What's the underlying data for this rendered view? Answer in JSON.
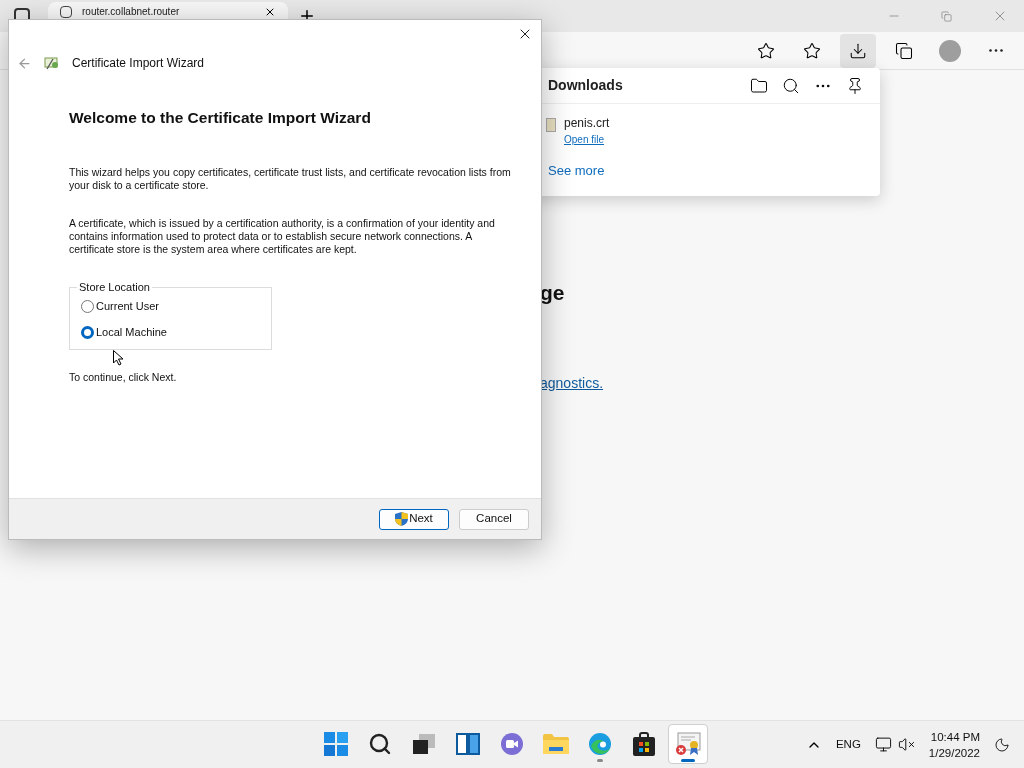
{
  "browser": {
    "tab": {
      "title": "router.collabnet.router"
    },
    "toolbar": [
      {
        "kind": "favorite-add",
        "selected": false
      },
      {
        "kind": "favorites",
        "selected": false
      },
      {
        "kind": "downloads",
        "selected": true
      },
      {
        "kind": "collections",
        "selected": false
      },
      {
        "kind": "profile",
        "selected": false
      },
      {
        "kind": "more",
        "selected": false
      }
    ],
    "page": {
      "heading": "ge",
      "link": "agnostics."
    }
  },
  "downloads": {
    "title": "Downloads",
    "items": [
      {
        "name": "penis.crt",
        "action": "Open file"
      }
    ],
    "see_more": "See more"
  },
  "dialog": {
    "title": "Certificate Import Wizard",
    "heading": "Welcome to the Certificate Import Wizard",
    "paragraphs": [
      "This wizard helps you copy certificates, certificate trust lists, and certificate revocation lists from your disk to a certificate store.",
      "A certificate, which is issued by a certification authority, is a confirmation of your identity and contains information used to protect data or to establish secure network connections. A certificate store is the system area where certificates are kept."
    ],
    "store_location": {
      "legend": "Store Location",
      "options": [
        {
          "label": "Current User",
          "selected": false
        },
        {
          "label": "Local Machine",
          "selected": true
        }
      ]
    },
    "continue_text": "To continue, click Next.",
    "buttons": [
      {
        "label": "Next",
        "kind": "primary"
      },
      {
        "label": "Cancel",
        "kind": "secondary"
      }
    ]
  },
  "taskbar": {
    "apps": [
      {
        "kind": "start",
        "running": false,
        "selected": false
      },
      {
        "kind": "search",
        "running": false,
        "selected": false
      },
      {
        "kind": "task-view",
        "running": false,
        "selected": false
      },
      {
        "kind": "widgets",
        "running": false,
        "selected": false
      },
      {
        "kind": "chat",
        "running": false,
        "selected": false
      },
      {
        "kind": "explorer",
        "running": false,
        "selected": false
      },
      {
        "kind": "edge",
        "running": true,
        "selected": false
      },
      {
        "kind": "store",
        "running": false,
        "selected": false
      },
      {
        "kind": "certificate",
        "running": true,
        "selected": true
      }
    ],
    "language": "ENG",
    "time": "10:44 PM",
    "date": "1/29/2022"
  }
}
